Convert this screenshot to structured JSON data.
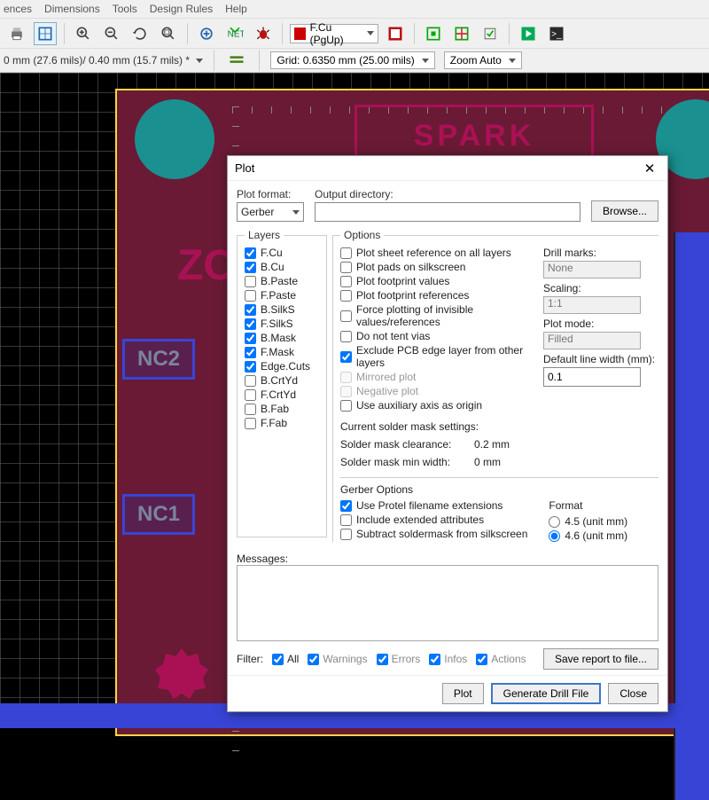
{
  "menubar": {
    "items": [
      "ences",
      "Dimensions",
      "Tools",
      "Design Rules",
      "Help"
    ]
  },
  "toolbar": {
    "layer_select": "F.Cu (PgUp)",
    "track_status": "0 mm (27.6 mils)/ 0.40 mm (15.7 mils) *",
    "grid_label": "Grid: 0.6350 mm (25.00 mils)",
    "zoom_label": "Zoom Auto"
  },
  "board": {
    "logo": "SPARK",
    "zoe": "ZO",
    "nc2": "NC2",
    "nc1": "NC1"
  },
  "dialog": {
    "title": "Plot",
    "plot_format_label": "Plot format:",
    "plot_format_value": "Gerber",
    "output_dir_label": "Output directory:",
    "output_dir_value": "",
    "browse": "Browse...",
    "layers_legend": "Layers",
    "layers": [
      {
        "label": "F.Cu",
        "checked": true
      },
      {
        "label": "B.Cu",
        "checked": true
      },
      {
        "label": "B.Paste",
        "checked": false
      },
      {
        "label": "F.Paste",
        "checked": false
      },
      {
        "label": "B.SilkS",
        "checked": true
      },
      {
        "label": "F.SilkS",
        "checked": true
      },
      {
        "label": "B.Mask",
        "checked": true
      },
      {
        "label": "F.Mask",
        "checked": true
      },
      {
        "label": "Edge.Cuts",
        "checked": true
      },
      {
        "label": "B.CrtYd",
        "checked": false
      },
      {
        "label": "F.CrtYd",
        "checked": false
      },
      {
        "label": "B.Fab",
        "checked": false
      },
      {
        "label": "F.Fab",
        "checked": false
      }
    ],
    "options_legend": "Options",
    "opts_left": [
      {
        "label": "Plot sheet reference on all layers",
        "checked": false,
        "disabled": false
      },
      {
        "label": "Plot pads on silkscreen",
        "checked": false,
        "disabled": false
      },
      {
        "label": "Plot footprint values",
        "checked": false,
        "disabled": false
      },
      {
        "label": "Plot footprint references",
        "checked": false,
        "disabled": false
      },
      {
        "label": "Force plotting of invisible values/references",
        "checked": false,
        "disabled": false
      },
      {
        "label": "Do not tent vias",
        "checked": false,
        "disabled": false
      },
      {
        "label": "Exclude PCB edge layer from other layers",
        "checked": true,
        "disabled": false
      },
      {
        "label": "Mirrored plot",
        "checked": false,
        "disabled": true
      },
      {
        "label": "Negative plot",
        "checked": false,
        "disabled": true
      },
      {
        "label": "Use auxiliary axis as origin",
        "checked": false,
        "disabled": false
      }
    ],
    "drill_marks_label": "Drill marks:",
    "drill_marks_value": "None",
    "scaling_label": "Scaling:",
    "scaling_value": "1:1",
    "plot_mode_label": "Plot mode:",
    "plot_mode_value": "Filled",
    "default_lw_label": "Default line width (mm):",
    "default_lw_value": "0.1",
    "mask_head": "Current solder mask settings:",
    "mask_clear_label": "Solder mask clearance:",
    "mask_clear_value": "0.2 mm",
    "mask_minw_label": "Solder mask min width:",
    "mask_minw_value": "0 mm",
    "gerber_legend": "Gerber Options",
    "gerber_opts": [
      {
        "label": "Use Protel filename extensions",
        "checked": true
      },
      {
        "label": "Include extended attributes",
        "checked": false
      },
      {
        "label": "Subtract soldermask from silkscreen",
        "checked": false
      }
    ],
    "format_legend": "Format",
    "format_opts": [
      {
        "label": "4.5 (unit mm)",
        "checked": false
      },
      {
        "label": "4.6 (unit mm)",
        "checked": true
      }
    ],
    "messages_label": "Messages:",
    "filter_label": "Filter:",
    "filter_all": "All",
    "filter_warnings": "Warnings",
    "filter_errors": "Errors",
    "filter_infos": "Infos",
    "filter_actions": "Actions",
    "save_report": "Save report to file...",
    "btn_plot": "Plot",
    "btn_drill": "Generate Drill File",
    "btn_close": "Close"
  }
}
